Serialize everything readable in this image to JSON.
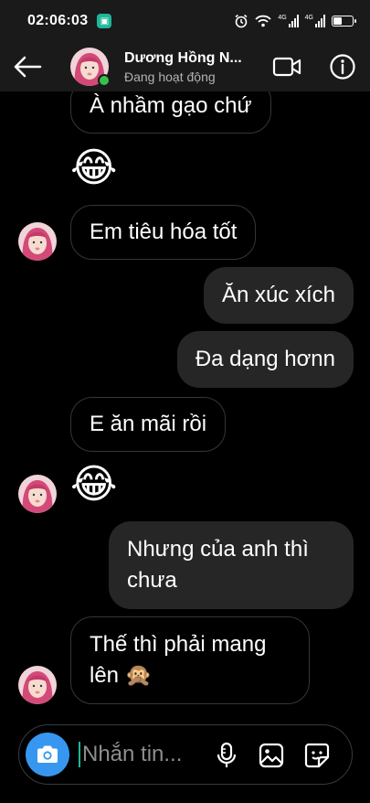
{
  "status_bar": {
    "time": "02:06:03",
    "network_1": "4G",
    "network_2": "4G"
  },
  "header": {
    "contact_name": "Dương Hồng N...",
    "contact_status": "Đang hoạt động"
  },
  "messages": [
    {
      "from": "contact",
      "text": "À nhầm gạo chứ"
    },
    {
      "from": "contact",
      "emoji": "😂"
    },
    {
      "from": "contact",
      "text": "Em tiêu hóa tốt"
    },
    {
      "from": "me",
      "text": "Ăn xúc xích"
    },
    {
      "from": "me",
      "text": "Đa dạng hơnn"
    },
    {
      "from": "contact",
      "text": "E ăn mãi rồi"
    },
    {
      "from": "contact",
      "emoji": "😂"
    },
    {
      "from": "me",
      "text": "Nhưng của anh thì chưa"
    },
    {
      "from": "contact",
      "text": "Thế thì phải mang lên 🙊"
    }
  ],
  "composer": {
    "placeholder": "Nhắn tin..."
  },
  "icons": {
    "back": "arrow-left-icon",
    "video": "video-camera-icon",
    "info": "info-icon",
    "camera": "camera-icon",
    "mic": "microphone-icon",
    "gallery": "image-icon",
    "sticker": "sticker-icon"
  },
  "colors": {
    "background": "#000000",
    "header_bg": "#1a1a1a",
    "outgoing_bubble": "#262626",
    "incoming_border": "#363636",
    "online": "#36c34a",
    "camera_button": "#3797f0"
  }
}
